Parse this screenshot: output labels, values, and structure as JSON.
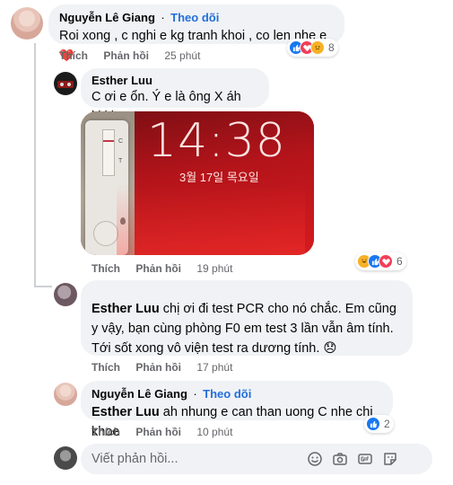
{
  "comments": [
    {
      "author": "Nguyễn Lê Giang",
      "follow": "Theo dõi",
      "text": "Roi xong , c nghi e kg tranh khoi , co len nhe e",
      "heart": "❤️",
      "actions": {
        "like": "Thích",
        "reply": "Phản hồi",
        "time": "25 phút"
      },
      "reaction_count": "8"
    },
    {
      "author": "Esther Luu",
      "text": "C ơi e ổn. Ý e là ông X áh kkkk",
      "photo": {
        "time": "14:38",
        "date": "3월 17일 목요일",
        "test_c": "C",
        "test_t": "T"
      },
      "actions": {
        "like": "Thích",
        "reply": "Phản hồi",
        "time": "19 phút"
      },
      "reaction_count": "6"
    },
    {
      "mention": "Esther Luu",
      "text": " chị ơi đi test PCR cho nó chắc. Em cũng y vậy, bạn cùng phòng F0 em test 3 lần vẫn âm tính. Tới sốt xong vô viện test ra dương tính. 😞",
      "actions": {
        "like": "Thích",
        "reply": "Phản hồi",
        "time": "17 phút"
      }
    },
    {
      "author": "Nguyễn Lê Giang",
      "follow": "Theo dõi",
      "mention": "Esther Luu",
      "text": " ah nhung e can than uong C nhe chi khoe",
      "actions": {
        "like": "Thích",
        "reply": "Phản hồi",
        "time": "10 phút"
      },
      "reaction_count": "2"
    }
  ],
  "composer": {
    "placeholder": "Viết phản hồi..."
  },
  "colors": {
    "bubble": "#f0f2f5",
    "link": "#216fdb",
    "like": "#1877f2",
    "love": "#f33e58",
    "haha": "#f7b125"
  },
  "icons": [
    "like-reaction-icon",
    "love-reaction-icon",
    "care-reaction-icon",
    "haha-reaction-icon",
    "emoji-icon",
    "camera-icon",
    "gif-icon",
    "sticker-icon"
  ]
}
